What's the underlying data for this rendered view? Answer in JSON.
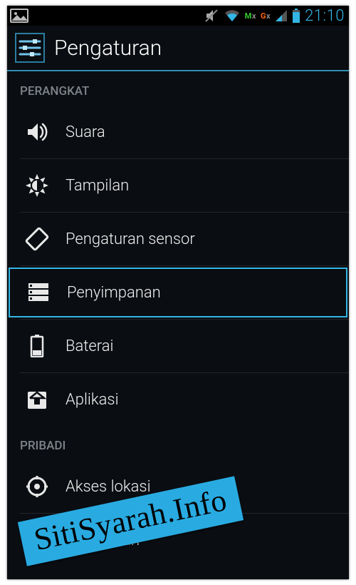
{
  "status": {
    "time": "21:10",
    "sim1": "M",
    "sim2": "G"
  },
  "header": {
    "title": "Pengaturan"
  },
  "sections": [
    {
      "title": "Perangkat",
      "items": [
        {
          "id": "sound",
          "label": "Suara",
          "selected": false
        },
        {
          "id": "display",
          "label": "Tampilan",
          "selected": false
        },
        {
          "id": "sensor",
          "label": "Pengaturan sensor",
          "selected": false
        },
        {
          "id": "storage",
          "label": "Penyimpanan",
          "selected": true
        },
        {
          "id": "battery",
          "label": "Baterai",
          "selected": false
        },
        {
          "id": "apps",
          "label": "Aplikasi",
          "selected": false
        }
      ]
    },
    {
      "title": "Pribadi",
      "items": [
        {
          "id": "location",
          "label": "Akses lokasi",
          "selected": false
        },
        {
          "id": "security",
          "label": "Keamanan",
          "selected": false
        }
      ]
    }
  ],
  "watermark": "SitiSyarah.Info"
}
